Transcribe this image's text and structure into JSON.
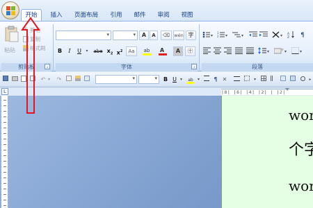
{
  "tabs": [
    {
      "label": "开始",
      "active": true
    },
    {
      "label": "插入",
      "active": false
    },
    {
      "label": "页面布局",
      "active": false
    },
    {
      "label": "引用",
      "active": false
    },
    {
      "label": "邮件",
      "active": false
    },
    {
      "label": "审阅",
      "active": false
    },
    {
      "label": "视图",
      "active": false
    }
  ],
  "clipboard": {
    "paste_label": "粘贴",
    "cut_label": "剪切",
    "copy_label": "复制",
    "format_painter_label": "格式刷",
    "group_label": "剪贴板"
  },
  "font": {
    "name_value": "",
    "size_value": "",
    "group_label": "字体",
    "grow_label": "A",
    "shrink_label": "A",
    "bold_label": "B",
    "italic_label": "I",
    "underline_label": "U",
    "strike_label": "abe",
    "subscript_label": "x",
    "superscript_label": "x",
    "highlight_label": "ab",
    "color_label": "A",
    "char_shading_label": "A",
    "enclose_label": "字",
    "phonetic_label": "wén"
  },
  "paragraph": {
    "group_label": "段落"
  },
  "toolbar2": {
    "bold_label": "B",
    "underline_label": "U",
    "style_value": "",
    "size_value": ""
  },
  "ruler": {
    "corner_label": "L",
    "marks": "|8|  |6|  |4|  |2|  |  |2|"
  },
  "document": {
    "lines": [
      "wor",
      "个字",
      "wor"
    ]
  },
  "colors": {
    "highlight": "#ffff00",
    "font_color": "#e02020",
    "arrow": "#e8141c",
    "page_bg": "#e5ffe5"
  },
  "icons": [
    "office-logo-icon",
    "paste-icon",
    "cut-icon",
    "copy-icon",
    "format-painter-icon",
    "bullets-icon",
    "numbering-icon",
    "align-left-icon",
    "center-icon",
    "align-right-icon",
    "justify-icon",
    "line-spacing-icon",
    "shading-icon",
    "save-icon",
    "undo-icon",
    "redo-icon"
  ]
}
